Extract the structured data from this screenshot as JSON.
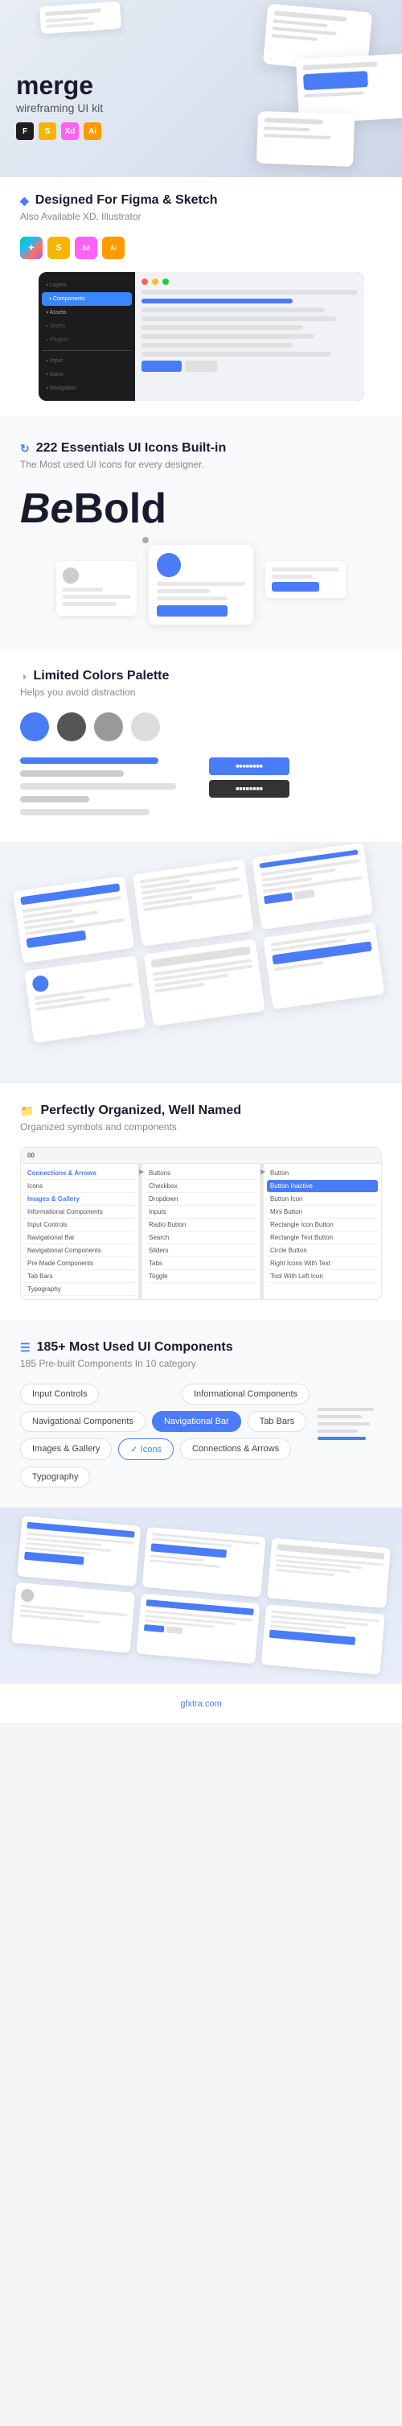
{
  "hero": {
    "title": "merge",
    "subtitle": "wireframing UI kit",
    "badges": [
      "figma",
      "sketch",
      "xd",
      "illustrator"
    ]
  },
  "designed": {
    "title": "Designed For Figma & Sketch",
    "subtitle": "Also Available XD, Illustrator"
  },
  "icons": {
    "title": "222 Essentials UI Icons Built-in",
    "subtitle": "The Most used UI Icons for every designer.",
    "bebold": "BeBold"
  },
  "colors": {
    "title": "Limited Colors Palette",
    "subtitle": "Helps you avoid distraction",
    "circles": [
      "#4a7cf7",
      "#555",
      "#999",
      "#ddd"
    ]
  },
  "organized": {
    "title": "Perfectly Organized, Well Named",
    "subtitle": "Organized symbols and components",
    "table": {
      "header": "00",
      "col1": {
        "rows": [
          "Connections & Arrows",
          "Icons",
          "Images & Gallery",
          "Informational Components",
          "Input Controls",
          "Navigational Bar",
          "Navigational Components",
          "Pre Made Components",
          "Tab Bars",
          "Typography"
        ]
      },
      "col2": {
        "rows": [
          "Buttons",
          "Checkbox",
          "Dropdown",
          "Inputs",
          "Radio Button",
          "Search",
          "Sliders",
          "Tabs",
          "Toggle"
        ]
      },
      "col3": {
        "rows": [
          "Button",
          "Button Inactive",
          "Button Icon",
          "Mini Button",
          "Rectangle Icon Button",
          "Rectangle Text Button",
          "Circle Button",
          "Right Icons With Text",
          "Tool With Left Icon"
        ]
      }
    }
  },
  "components": {
    "title": "185+ Most Used UI Components",
    "subtitle": "185 Pre-built Components In 10 category",
    "tags": [
      {
        "label": "Input Controls",
        "state": "normal"
      },
      {
        "label": "Informational Components",
        "state": "normal"
      },
      {
        "label": "Navigational Components",
        "state": "normal"
      },
      {
        "label": "Navigational Bar",
        "state": "active"
      },
      {
        "label": "Tab Bars",
        "state": "normal"
      },
      {
        "label": "Images & Gallery",
        "state": "normal"
      },
      {
        "label": "Icons",
        "state": "checked"
      },
      {
        "label": "Connections & Arrows",
        "state": "normal"
      },
      {
        "label": "Typography",
        "state": "normal"
      }
    ]
  },
  "footer": {
    "text": "gfxtra.com"
  }
}
